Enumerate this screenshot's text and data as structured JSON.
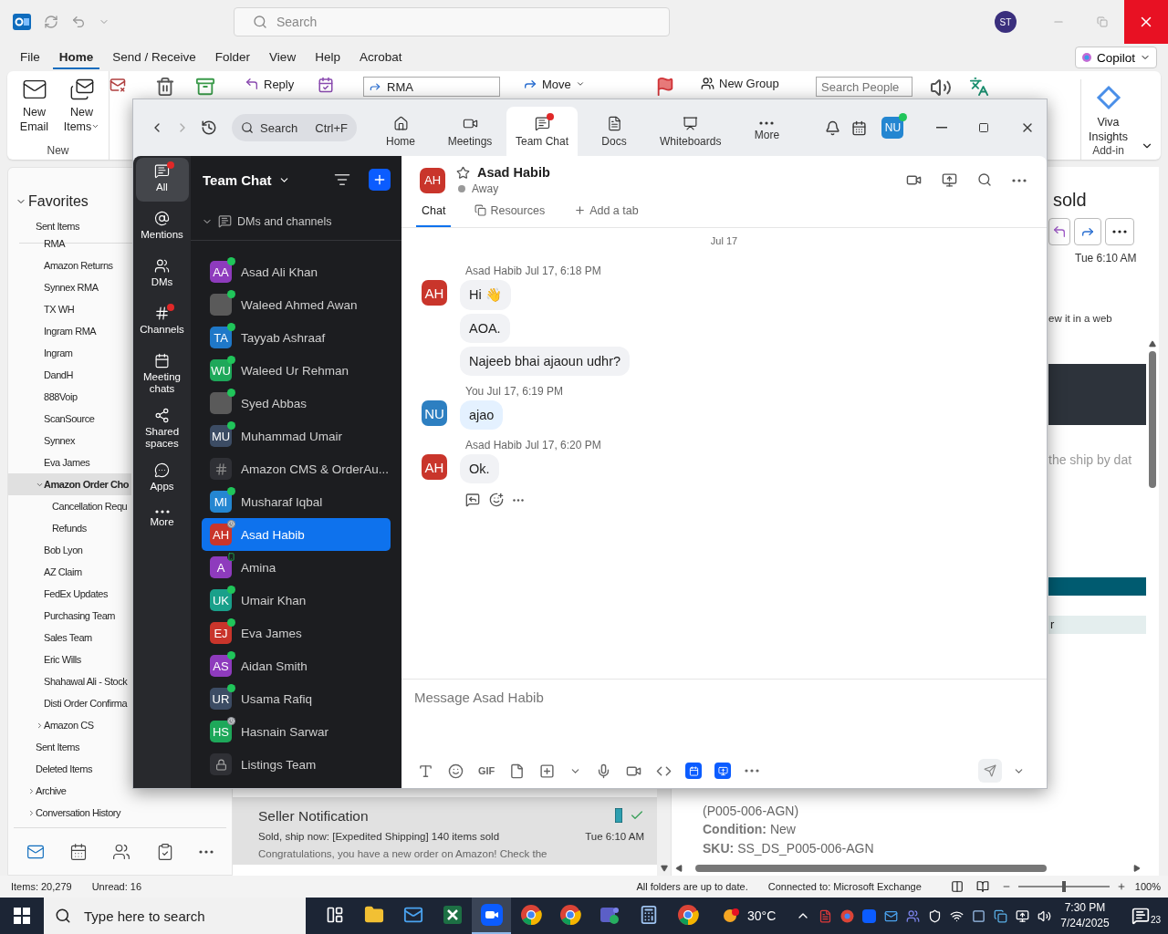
{
  "outlook": {
    "title_bar": {
      "search_placeholder": "Search",
      "avatar": "ST"
    },
    "menu": [
      {
        "label": "File",
        "selected": false
      },
      {
        "label": "Home",
        "selected": true
      },
      {
        "label": "Send / Receive",
        "selected": false
      },
      {
        "label": "Folder",
        "selected": false
      },
      {
        "label": "View",
        "selected": false
      },
      {
        "label": "Help",
        "selected": false
      },
      {
        "label": "Acrobat",
        "selected": false
      }
    ],
    "copilot": "Copilot",
    "ribbon": {
      "new_email": "New Email",
      "new_items": "New Items",
      "new_group_label": "New",
      "reply": "Reply",
      "quick_step": "RMA",
      "move": "Move",
      "new_group": "New Group",
      "search_people_placeholder": "Search People",
      "viva": "Viva Insights",
      "addin_label": "Add-in"
    },
    "folder_pane": {
      "favorites": {
        "label": "Favorites",
        "expanded": true,
        "children": [
          {
            "label": "Sent Items",
            "selected": false
          }
        ]
      },
      "subfolders": [
        {
          "label": "RMA",
          "selected": false
        },
        {
          "label": "Amazon Returns",
          "selected": false
        },
        {
          "label": "Synnex RMA",
          "selected": false
        },
        {
          "label": "TX WH",
          "selected": false
        },
        {
          "label": "Ingram RMA",
          "selected": false
        },
        {
          "label": "Ingram",
          "selected": false
        },
        {
          "label": "DandH",
          "selected": false
        },
        {
          "label": "888Voip",
          "selected": false
        },
        {
          "label": "ScanSource",
          "selected": false
        },
        {
          "label": "Synnex",
          "selected": false
        },
        {
          "label": "Eva James",
          "selected": false
        },
        {
          "label": "Amazon Order Cho",
          "selected": true,
          "expanded": true,
          "children": [
            {
              "label": "Cancellation Requ",
              "selected": false
            },
            {
              "label": "Refunds",
              "selected": false
            }
          ]
        },
        {
          "label": "Bob Lyon",
          "selected": false
        },
        {
          "label": "AZ Claim",
          "selected": false
        },
        {
          "label": "FedEx Updates",
          "selected": false
        },
        {
          "label": "Purchasing Team",
          "selected": false
        },
        {
          "label": "Sales Team",
          "selected": false
        },
        {
          "label": "Eric Wills",
          "selected": false
        },
        {
          "label": "Shahawal Ali - Stock",
          "selected": false
        },
        {
          "label": "Disti Order Confirma",
          "selected": false
        },
        {
          "label": "Amazon CS",
          "selected": false,
          "expanded": false
        }
      ],
      "folders": [
        {
          "label": "Sent Items",
          "selected": false
        },
        {
          "label": "Deleted Items",
          "selected": false
        },
        {
          "label": "Archive",
          "selected": false,
          "expanded": false
        },
        {
          "label": "Conversation History",
          "selected": false,
          "expanded": false
        }
      ],
      "nav": [
        {
          "kind": "mail",
          "selected": true
        },
        {
          "kind": "calendar",
          "selected": false
        },
        {
          "kind": "people",
          "selected": false
        },
        {
          "kind": "tasks",
          "selected": false
        },
        {
          "kind": "more",
          "selected": false
        }
      ]
    },
    "message_list": {
      "messages": [
        {
          "sender": "Seller Notification",
          "subject": "Sold, ship now: [Expedited Shipping] 140 items sold",
          "preview": "Congratulations, you have a new order on Amazon! Check the",
          "time": "Tue 6:10 AM",
          "selected": true
        }
      ]
    },
    "reading_pane": {
      "subject_fragment": "sold",
      "time": "Tue 6:10 AM",
      "body_fragments": [
        "ew it in a web",
        "the ship by dat",
        "r"
      ],
      "details": [
        {
          "value": "(P005-006-AGN)"
        },
        {
          "label": "Condition:",
          "value": "New"
        },
        {
          "label": "SKU:",
          "value": "SS_DS_P005-006-AGN"
        }
      ]
    },
    "status_bar": {
      "items": "Items: 20,279",
      "unread": "Unread: 16",
      "sync": "All folders are up to date.",
      "connection": "Connected to: Microsoft Exchange",
      "zoom": {
        "level": 0.5
      },
      "zoom_reading": "100%"
    }
  },
  "zoom": {
    "search": {
      "placeholder": "Search",
      "shortcut": "Ctrl+F"
    },
    "tabs": [
      {
        "label": "Home",
        "kind": "home",
        "selected": false,
        "badge": false
      },
      {
        "label": "Meetings",
        "kind": "meetings",
        "selected": false,
        "badge": false
      },
      {
        "label": "Team Chat",
        "kind": "chat",
        "selected": true,
        "badge": true
      },
      {
        "label": "Docs",
        "kind": "docs",
        "selected": false,
        "badge": false
      },
      {
        "label": "Whiteboards",
        "kind": "whiteboards",
        "selected": false,
        "badge": false
      },
      {
        "label": "More",
        "kind": "more",
        "selected": false,
        "badge": false
      }
    ],
    "user": {
      "initials": "NU",
      "online": true
    },
    "nav": [
      {
        "label": "All",
        "kind": "all",
        "selected": true,
        "badge": true
      },
      {
        "label": "Mentions",
        "kind": "mentions",
        "selected": false,
        "badge": false
      },
      {
        "label": "DMs",
        "kind": "dms",
        "selected": false,
        "badge": false
      },
      {
        "label": "Channels",
        "kind": "channels",
        "selected": false,
        "badge": true
      },
      {
        "label": "Meeting chats",
        "kind": "meetings",
        "selected": false,
        "badge": false
      },
      {
        "label": "Shared spaces",
        "kind": "shared",
        "selected": false,
        "badge": false
      },
      {
        "label": "Apps",
        "kind": "apps",
        "selected": false,
        "badge": false
      },
      {
        "label": "More",
        "kind": "more",
        "selected": false,
        "badge": false
      }
    ],
    "sidebar": {
      "title": "Team Chat",
      "section": {
        "label": "DMs and channels",
        "expanded": true
      },
      "contacts": [
        {
          "name": "Asad Ali Khan",
          "kind": "person",
          "initials": "AA",
          "color": "#8e3bbd",
          "online": true,
          "away": false,
          "mobile": false,
          "selected": false
        },
        {
          "name": "Waleed Ahmed Awan",
          "kind": "photo",
          "online": true,
          "away": false,
          "mobile": false,
          "selected": false
        },
        {
          "name": "Tayyab Ashraaf",
          "kind": "person",
          "initials": "TA",
          "color": "#1f78c8",
          "online": true,
          "away": false,
          "mobile": false,
          "selected": false
        },
        {
          "name": "Waleed Ur Rehman",
          "kind": "person",
          "initials": "WU",
          "color": "#1ea85a",
          "online": true,
          "away": false,
          "mobile": false,
          "selected": false
        },
        {
          "name": "Syed Abbas",
          "kind": "photo",
          "online": true,
          "away": false,
          "mobile": false,
          "selected": false
        },
        {
          "name": "Muhammad Umair",
          "kind": "person",
          "initials": "MU",
          "color": "#3c4c64",
          "online": true,
          "away": false,
          "mobile": false,
          "selected": false
        },
        {
          "name": "Amazon CMS & OrderAu...",
          "kind": "channel",
          "online": false,
          "away": false,
          "mobile": false,
          "selected": false
        },
        {
          "name": "Musharaf Iqbal",
          "kind": "person",
          "initials": "MI",
          "color": "#2486d1",
          "online": true,
          "away": false,
          "mobile": false,
          "selected": false
        },
        {
          "name": "Asad Habib",
          "kind": "person",
          "initials": "AH",
          "color": "#c9352b",
          "online": false,
          "away": true,
          "mobile": false,
          "selected": true
        },
        {
          "name": "Amina",
          "kind": "person",
          "initials": "A",
          "color": "#8e3bbd",
          "online": false,
          "away": false,
          "mobile": true,
          "selected": false
        },
        {
          "name": "Umair Khan",
          "kind": "person",
          "initials": "UK",
          "color": "#19a08a",
          "online": true,
          "away": false,
          "mobile": false,
          "selected": false
        },
        {
          "name": "Eva James",
          "kind": "person",
          "initials": "EJ",
          "color": "#c9352b",
          "online": true,
          "away": false,
          "mobile": false,
          "selected": false
        },
        {
          "name": "Aidan Smith",
          "kind": "person",
          "initials": "AS",
          "color": "#8e3bbd",
          "online": true,
          "away": false,
          "mobile": false,
          "selected": false
        },
        {
          "name": "Usama Rafiq",
          "kind": "person",
          "initials": "UR",
          "color": "#3c4c64",
          "online": true,
          "away": false,
          "mobile": false,
          "selected": false
        },
        {
          "name": "Hasnain Sarwar",
          "kind": "person",
          "initials": "HS",
          "color": "#1ea85a",
          "online": false,
          "away": true,
          "mobile": false,
          "selected": false
        },
        {
          "name": "Listings Team",
          "kind": "private_channel",
          "online": false,
          "away": false,
          "mobile": false,
          "selected": false
        }
      ]
    },
    "chat": {
      "contact": {
        "name": "Asad Habib",
        "initials": "AH",
        "color": "#c9352b",
        "status": "Away",
        "starred": false
      },
      "tabs": [
        {
          "label": "Chat",
          "selected": true
        },
        {
          "label": "Resources",
          "selected": false
        }
      ],
      "add_tab": "Add a tab",
      "date": "Jul 17",
      "groups": [
        {
          "sender": "Asad Habib",
          "initials": "AH",
          "color": "#c9352b",
          "time": "Jul 17, 6:18 PM",
          "self": false,
          "show_actions": false,
          "messages": [
            "Hi 👋",
            "AOA.",
            "Najeeb bhai ajaoun udhr?"
          ]
        },
        {
          "sender": "You",
          "initials": "NU",
          "color": "#2d7fc1",
          "time": "Jul 17, 6:19 PM",
          "self": true,
          "show_actions": false,
          "messages": [
            "ajao"
          ]
        },
        {
          "sender": "Asad Habib",
          "initials": "AH",
          "color": "#c9352b",
          "time": "Jul 17, 6:20 PM",
          "self": false,
          "show_actions": true,
          "messages": [
            "Ok."
          ]
        }
      ]
    },
    "composer": {
      "placeholder": "Message Asad Habib",
      "gif": "GIF",
      "send_enabled": false
    }
  },
  "taskbar": {
    "search_placeholder": "Type here to search",
    "apps": [
      {
        "kind": "taskview",
        "active": false
      },
      {
        "kind": "explorer",
        "active": false
      },
      {
        "kind": "outlook",
        "active": false
      },
      {
        "kind": "excel",
        "active": false
      },
      {
        "kind": "zoom",
        "active": true
      },
      {
        "kind": "chrome",
        "active": false
      },
      {
        "kind": "chrome",
        "active": false
      },
      {
        "kind": "teams",
        "active": false
      },
      {
        "kind": "calculator",
        "active": false
      },
      {
        "kind": "chrome",
        "active": false
      }
    ],
    "weather": "30°C",
    "time": "7:30 PM",
    "date": "7/24/2025",
    "notifications": "23"
  }
}
